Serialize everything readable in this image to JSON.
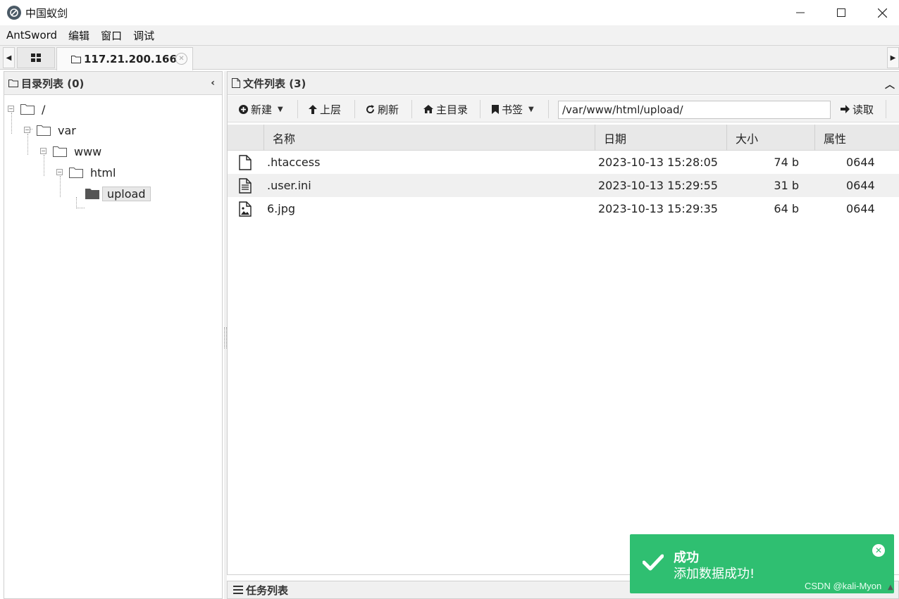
{
  "window": {
    "title": "中国蚁剑",
    "logo_icon": "antsword-logo-icon"
  },
  "menu": [
    "AntSword",
    "编辑",
    "窗口",
    "调试"
  ],
  "tabs": {
    "active_label": "117.21.200.166"
  },
  "left_panel": {
    "title": "目录列表 (0)",
    "tree": [
      {
        "label": "/",
        "depth": 0
      },
      {
        "label": "var",
        "depth": 1
      },
      {
        "label": "www",
        "depth": 2
      },
      {
        "label": "html",
        "depth": 3
      },
      {
        "label": "upload",
        "depth": 4,
        "selected": true
      }
    ]
  },
  "right_panel": {
    "title": "文件列表 (3)",
    "toolbar": {
      "new_label": "新建",
      "up_label": "上层",
      "refresh_label": "刷新",
      "home_label": "主目录",
      "bookmark_label": "书签",
      "path_value": "/var/www/html/upload/",
      "read_label": "读取"
    },
    "columns": {
      "name": "名称",
      "date": "日期",
      "size": "大小",
      "attr": "属性"
    },
    "files": [
      {
        "icon": "file-icon",
        "name": ".htaccess",
        "date": "2023-10-13 15:28:05",
        "size": "74 b",
        "attr": "0644"
      },
      {
        "icon": "text-file-icon",
        "name": ".user.ini",
        "date": "2023-10-13 15:29:55",
        "size": "31 b",
        "attr": "0644"
      },
      {
        "icon": "image-file-icon",
        "name": "6.jpg",
        "date": "2023-10-13 15:29:35",
        "size": "64 b",
        "attr": "0644"
      }
    ]
  },
  "task_panel": {
    "title": "任务列表"
  },
  "toast": {
    "title": "成功",
    "message": "添加数据成功!",
    "color": "#2fbf71"
  },
  "watermark": "CSDN @kali-Myon"
}
